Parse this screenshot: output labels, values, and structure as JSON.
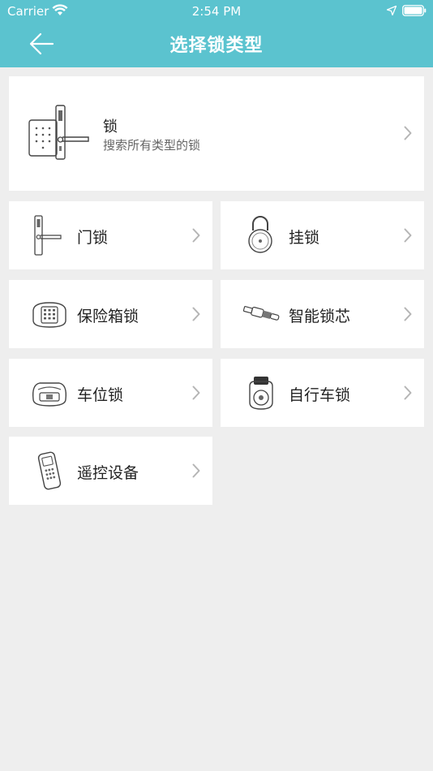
{
  "status_bar": {
    "carrier": "Carrier",
    "time": "2:54 PM",
    "icons": [
      "wifi-icon",
      "location-arrow-icon",
      "battery-icon"
    ]
  },
  "header": {
    "title": "选择锁类型",
    "back_icon": "arrow-left-icon",
    "background_color": "#5bc3cf"
  },
  "all_locks": {
    "title": "锁",
    "subtitle": "搜索所有类型的锁",
    "icon": "smart-door-lock-icon"
  },
  "categories": [
    {
      "label": "门锁",
      "icon": "door-lock-icon"
    },
    {
      "label": "挂锁",
      "icon": "padlock-icon"
    },
    {
      "label": "保险箱锁",
      "icon": "safe-lock-icon"
    },
    {
      "label": "智能锁芯",
      "icon": "lock-cylinder-icon"
    },
    {
      "label": "车位锁",
      "icon": "parking-lock-icon"
    },
    {
      "label": "自行车锁",
      "icon": "bike-lock-icon"
    },
    {
      "label": "遥控设备",
      "icon": "remote-control-icon"
    }
  ],
  "colors": {
    "page_background": "#eeeeee",
    "card_background": "#ffffff",
    "chevron": "#b5b5b5"
  }
}
